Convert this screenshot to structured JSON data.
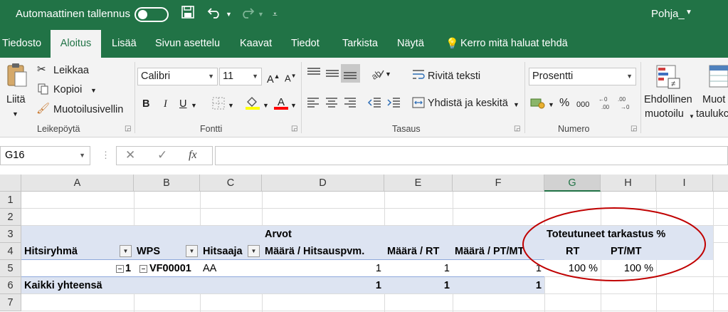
{
  "titlebar": {
    "autosave_label": "Automaattinen tallennus",
    "document_name": "Pohja_",
    "save_icon": "save-icon",
    "undo_icon": "undo-icon",
    "redo_icon": "redo-icon",
    "customize_icon": "customize-qat-icon"
  },
  "tabs": [
    "Tiedosto",
    "Aloitus",
    "Lisää",
    "Sivun asettelu",
    "Kaavat",
    "Tiedot",
    "Tarkista",
    "Näytä"
  ],
  "active_tab": "Aloitus",
  "tell_me": "Kerro mitä haluat tehdä",
  "ribbon": {
    "clipboard": {
      "paste": "Liitä",
      "cut": "Leikkaa",
      "copy": "Kopioi",
      "format_painter": "Muotoilusivellin",
      "label": "Leikepöytä"
    },
    "font": {
      "name": "Calibri",
      "size": "11",
      "label": "Fontti",
      "bold": "B",
      "italic": "I",
      "underline": "U",
      "grow": "A",
      "shrink": "A",
      "fill_color": "#ffff00",
      "font_color": "#ff0000"
    },
    "alignment": {
      "wrap_text": "Rivitä teksti",
      "merge_center": "Yhdistä ja keskitä",
      "label": "Tasaus"
    },
    "number": {
      "format": "Prosentti",
      "percent": "%",
      "thousands": "000",
      "label": "Numero"
    },
    "styles": {
      "conditional_line1": "Ehdollinen",
      "conditional_line2": "muotoilu",
      "format_table_line1": "Muot",
      "format_table_line2": "taulukc"
    }
  },
  "formula_bar": {
    "name_box": "G16",
    "cancel": "✕",
    "enter": "✓",
    "fx": "fx",
    "value": ""
  },
  "sheet": {
    "columns": [
      "A",
      "B",
      "C",
      "D",
      "E",
      "F",
      "G",
      "H",
      "I"
    ],
    "selected_column": "G",
    "rows": [
      "1",
      "2",
      "3",
      "4",
      "5",
      "6",
      "7"
    ],
    "pivot": {
      "values_header": "Arvot",
      "group_header": "Toteutuneet tarkastus %",
      "headers": {
        "hitsiryhma": "Hitsiryhmä",
        "wps": "WPS",
        "hitsaaja": "Hitsaaja",
        "maara_hitsauspvm": "Määrä  / Hitsauspvm.",
        "maara_rt": "Määrä  / RT",
        "maara_ptmt": "Määrä  / PT/MT",
        "rt": "RT",
        "ptmt": "PT/MT"
      },
      "row5": {
        "group": "1",
        "wps": "VF00001",
        "welder": "AA",
        "d": "1",
        "e": "1",
        "f": "1",
        "g": "100 %",
        "h": "100 %"
      },
      "total": {
        "label": "Kaikki yhteensä",
        "d": "1",
        "e": "1",
        "f": "1"
      }
    },
    "annotation_color": "#c00000"
  }
}
